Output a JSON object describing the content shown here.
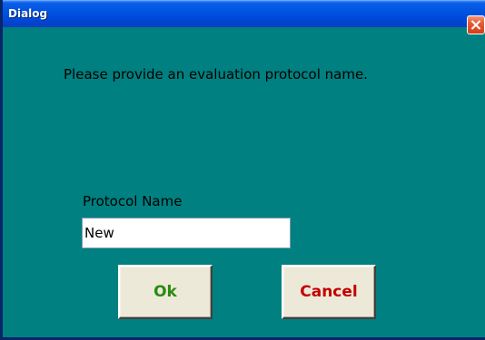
{
  "window": {
    "title": "Dialog",
    "close_icon": "close-icon"
  },
  "prompt": {
    "text": "Please provide an evaluation protocol name."
  },
  "form": {
    "field_label": "Protocol Name",
    "field_value": "New"
  },
  "buttons": {
    "ok_label": "Ok",
    "cancel_label": "Cancel"
  },
  "colors": {
    "background": "#008080",
    "titlebar": "#0052e0",
    "ok_text": "#2a8a10",
    "cancel_text": "#c40000",
    "close_button": "#e55b36"
  }
}
